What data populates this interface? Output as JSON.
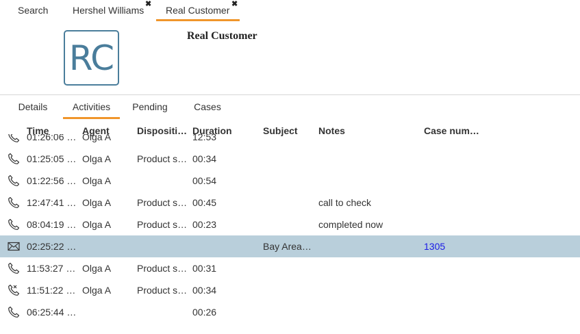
{
  "top_tabs": [
    {
      "label": "Search",
      "closable": false,
      "active": false
    },
    {
      "label": "Hershel Williams",
      "closable": true,
      "active": false
    },
    {
      "label": "Real Customer",
      "closable": true,
      "active": true
    }
  ],
  "close_glyph": "✖",
  "customer": {
    "initials": "RC",
    "name": "Real Customer"
  },
  "sub_tabs": [
    {
      "label": "Details",
      "active": false
    },
    {
      "label": "Activities",
      "active": true
    },
    {
      "label": "Pending",
      "active": false
    },
    {
      "label": "Cases",
      "active": false
    }
  ],
  "columns": [
    "Time",
    "Agent",
    "Dispositi…",
    "Duration",
    "Subject",
    "Notes",
    "Case num…"
  ],
  "rows": [
    {
      "icon": "phone-icon",
      "time": "01:26:06 …",
      "agent": "Olga A",
      "disposition": "",
      "duration": "12:53",
      "subject": "",
      "notes": "",
      "case": ""
    },
    {
      "icon": "phone-icon",
      "time": "01:25:05 …",
      "agent": "Olga A",
      "disposition": "Product s…",
      "duration": "00:34",
      "subject": "",
      "notes": "",
      "case": ""
    },
    {
      "icon": "phone-icon",
      "time": "01:22:56 …",
      "agent": "Olga A",
      "disposition": "",
      "duration": "00:54",
      "subject": "",
      "notes": "",
      "case": ""
    },
    {
      "icon": "phone-icon",
      "time": "12:47:41 …",
      "agent": "Olga A",
      "disposition": "Product s…",
      "duration": "00:45",
      "subject": "",
      "notes": "call to check",
      "case": ""
    },
    {
      "icon": "phone-icon",
      "time": "08:04:19 …",
      "agent": "Olga A",
      "disposition": "Product s…",
      "duration": "00:23",
      "subject": "",
      "notes": "completed now",
      "case": ""
    },
    {
      "icon": "envelope-icon",
      "time": "02:25:22 …",
      "agent": "",
      "disposition": "",
      "duration": "",
      "subject": "Bay Area…",
      "notes": "",
      "case": "1305",
      "selected": true
    },
    {
      "icon": "phone-icon",
      "time": "11:53:27 …",
      "agent": "Olga A",
      "disposition": "Product s…",
      "duration": "00:31",
      "subject": "",
      "notes": "",
      "case": ""
    },
    {
      "icon": "phone-missed-icon",
      "time": "11:51:22 …",
      "agent": "Olga A",
      "disposition": "Product s…",
      "duration": "00:34",
      "subject": "",
      "notes": "",
      "case": ""
    },
    {
      "icon": "phone-icon",
      "time": "06:25:44 …",
      "agent": "",
      "disposition": "",
      "duration": "00:26",
      "subject": "",
      "notes": "",
      "case": ""
    }
  ],
  "colors": {
    "accent": "#f0952b",
    "selected_row": "#b9cfdb",
    "avatar": "#4a7d9b",
    "link": "#1a1ae6"
  }
}
